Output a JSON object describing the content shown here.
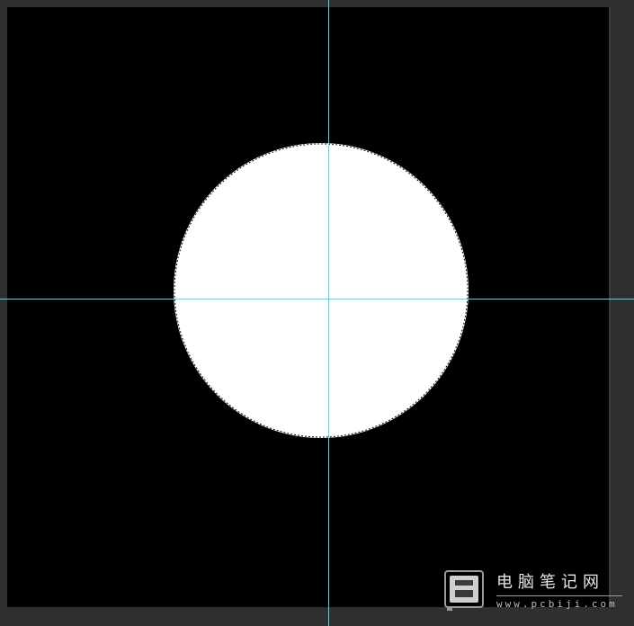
{
  "colors": {
    "workspace": "#2f2f2f",
    "canvas_fill": "#000000",
    "shape_fill": "#ffffff",
    "guide": "#4fd6e8",
    "watermark_text": "#e6e6e6"
  },
  "canvas": {
    "shape": "circle",
    "selection": "marching-ants"
  },
  "watermark": {
    "logo_icon": "pcbiji-logo-icon",
    "title": "电脑笔记网",
    "url": "www.pcbiji.com"
  }
}
